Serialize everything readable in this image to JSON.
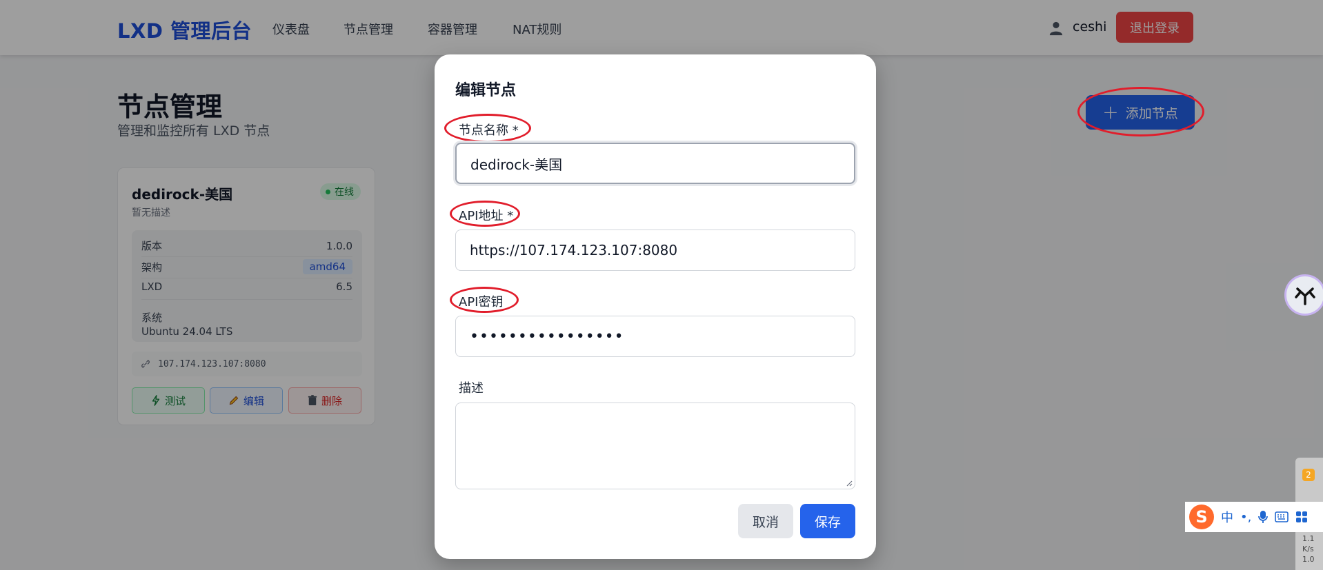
{
  "navbar": {
    "brand": "LXD 管理后台",
    "links": [
      "仪表盘",
      "节点管理",
      "容器管理",
      "NAT规则"
    ],
    "username": "ceshi",
    "logout_label": "退出登录"
  },
  "page": {
    "title": "节点管理",
    "subtitle": "管理和监控所有 LXD 节点",
    "add_node_label": "添加节点"
  },
  "node_card": {
    "name": "dedirock-美国",
    "description": "暂无描述",
    "status": "在线",
    "info": {
      "version_label": "版本",
      "version_value": "1.0.0",
      "arch_label": "架构",
      "arch_value": "amd64",
      "lxd_label": "LXD",
      "lxd_value": "6.5",
      "os_label": "系统",
      "os_value": "Ubuntu 24.04 LTS"
    },
    "endpoint": "107.174.123.107:8080",
    "actions": {
      "test": "测试",
      "edit": "编辑",
      "delete": "删除"
    }
  },
  "modal": {
    "title": "编辑节点",
    "fields": {
      "name_label": "节点名称 *",
      "name_value": "dedirock-美国",
      "api_url_label": "API地址 *",
      "api_url_value": "https://107.174.123.107:8080",
      "api_key_label": "API密钥",
      "api_key_value": "••••••••••••••••",
      "description_label": "描述",
      "description_value": ""
    },
    "cancel_label": "取消",
    "save_label": "保存"
  },
  "ime": {
    "logo": "S",
    "mode": "中",
    "punct": "•,",
    "badge": "2",
    "speed_lines": [
      "1.1",
      "K/s",
      "1.0"
    ]
  },
  "colors": {
    "primary": "#2563eb",
    "danger": "#ef4444",
    "success": "#22c55e",
    "annotation": "#e11d2b"
  }
}
